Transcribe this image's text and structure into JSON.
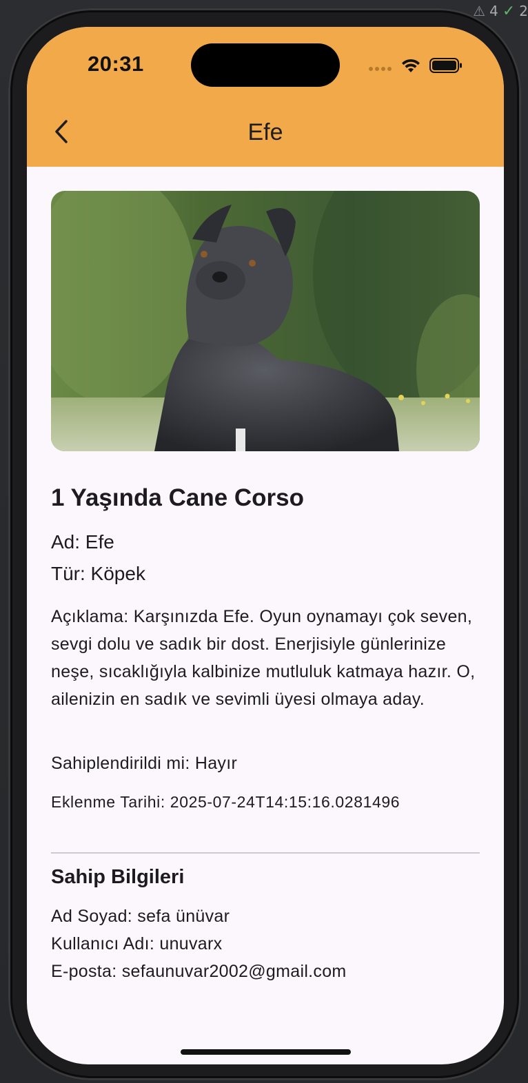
{
  "ide": {
    "warning_count": "4",
    "check_count": "2"
  },
  "status_bar": {
    "time": "20:31"
  },
  "app_bar": {
    "title": "Efe",
    "back_icon": "chevron-left-icon",
    "background_color": "#f2a949"
  },
  "pet": {
    "photo_alt": "Cane Corso",
    "heading": "1 Yaşında Cane Corso",
    "name_line": "Ad: Efe",
    "type_line": "Tür: Köpek",
    "description": "Açıklama: Karşınızda Efe. Oyun oynamayı çok seven, sevgi dolu ve sadık bir dost. Enerjisiyle günlerinize neşe, sıcaklığıyla kalbinize mutluluk katmaya hazır. O, ailenizin en sadık ve sevimli üyesi olmaya aday.",
    "adopted_line": "Sahiplendirildi mi: Hayır",
    "date_line": "Eklenme Tarihi: 2025-07-24T14:15:16.0281496"
  },
  "owner": {
    "heading": "Sahip Bilgileri",
    "full_name_line": "Ad Soyad: sefa ünüvar",
    "username_line": "Kullanıcı Adı: unuvarx",
    "email_line": "E-posta: sefaunuvar2002@gmail.com"
  }
}
